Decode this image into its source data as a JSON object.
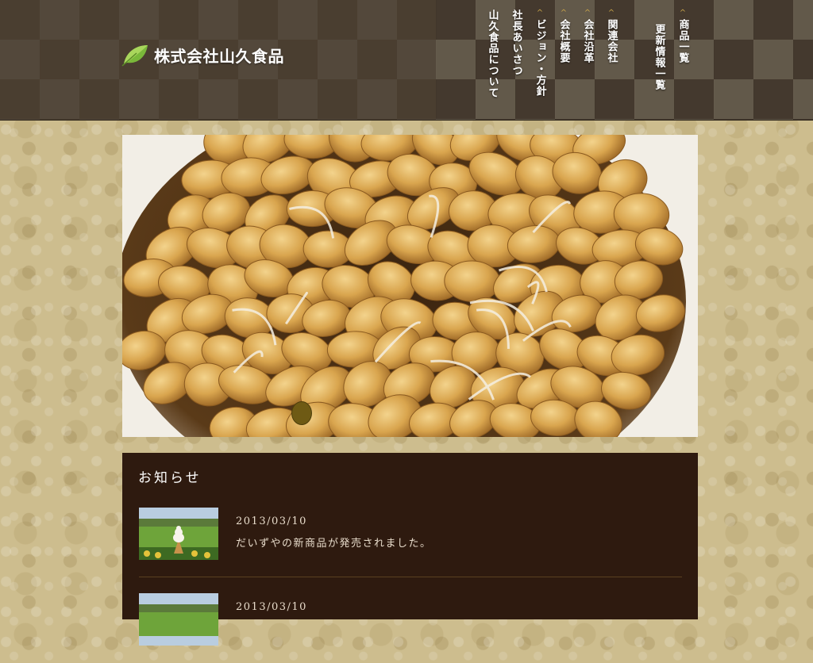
{
  "header": {
    "logo_text": "株式会社山久食品"
  },
  "nav": {
    "items": [
      {
        "label": "山久食品について",
        "caret": false
      },
      {
        "label": "社長あいさつ",
        "caret": false
      },
      {
        "label": "ビジョン・方針",
        "caret": true
      },
      {
        "label": "会社概要",
        "caret": true
      },
      {
        "label": "会社沿革",
        "caret": true
      },
      {
        "label": "関連会社",
        "caret": true
      },
      {
        "label": "更新情報一覧",
        "caret": false
      },
      {
        "label": "商品一覧",
        "caret": true
      }
    ],
    "caret_glyph": "^"
  },
  "news": {
    "heading": "お知らせ",
    "items": [
      {
        "date": "2013/03/10",
        "text": "だいずやの新商品が発売されました。"
      },
      {
        "date": "2013/03/10",
        "text": ""
      }
    ]
  },
  "colors": {
    "header_bg": "#4a3e30",
    "news_bg": "#2e1a0f",
    "accent_gold": "#c9a54a",
    "page_bg": "#cdbd8e"
  }
}
